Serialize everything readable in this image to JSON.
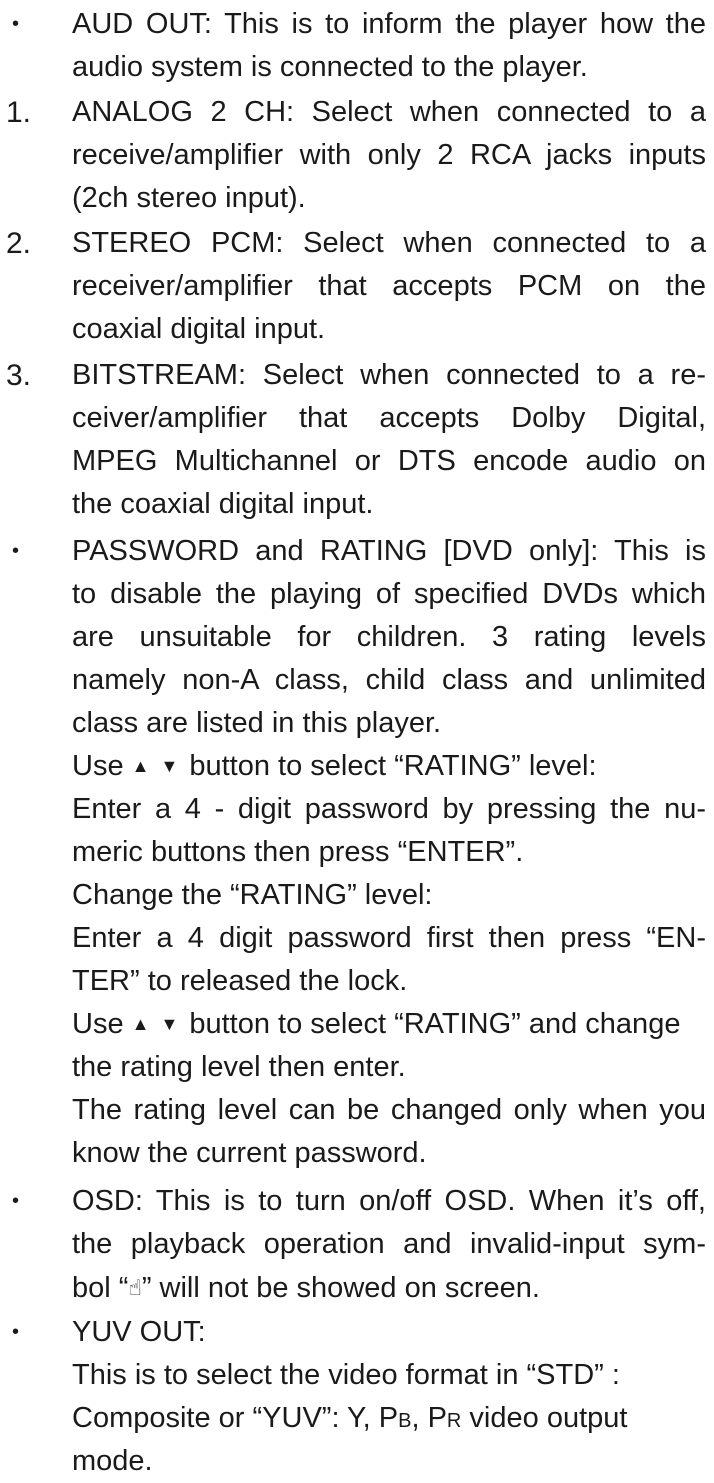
{
  "items": {
    "aud_out": {
      "marker": "•",
      "l1": "AUD OUT: This is to inform the player how the",
      "l2": "audio system is connected to the player."
    },
    "analog": {
      "marker": "1.",
      "l1": "ANALOG 2 CH: Select when connected to a",
      "l2": "receive/amplifier with only 2 RCA jacks inputs",
      "l3": "(2ch stereo input)."
    },
    "stereo_pcm": {
      "marker": "2.",
      "l1": "STEREO PCM: Select when connected to a",
      "l2": "receiver/amplifier that accepts PCM on the",
      "l3": "coaxial digital input."
    },
    "bitstream": {
      "marker": "3.",
      "l1": "BITSTREAM: Select when connected to a re-",
      "l2": "ceiver/amplifier that accepts Dolby Digital,",
      "l3": "MPEG Multichannel or DTS encode audio on",
      "l4": "the coaxial digital input."
    },
    "password": {
      "marker": "•",
      "l1": "PASSWORD and RATING [DVD only]: This is",
      "l2": "to disable the playing of specified DVDs which",
      "l3": "are unsuitable for children. 3 rating levels",
      "l4": "namely non-A class, child class and unlimited",
      "l5": "class are listed in this player.",
      "l6_pre": "Use",
      "arrows": "▲ ▼",
      "l6_post": "button to select “RATING” level:",
      "l7": "Enter a 4 - digit password by pressing the nu-",
      "l8": "meric buttons then press “ENTER”.",
      "l9": "Change the “RATING” level:",
      "l10": "Enter a  4 digit password first then press “EN-",
      "l11": "TER” to released the lock.",
      "l12_pre": "Use",
      "l12_post": "button to select “RATING” and change",
      "l13": "the rating level then enter.",
      "l14": "The rating level can be changed only when you",
      "l15": "know the current password."
    },
    "osd": {
      "marker": "•",
      "l1": "OSD: This is to turn on/off OSD. When it’s off,",
      "l2": "the playback operation and invalid-input sym-",
      "l3_pre": "bol “",
      "hand": "☝",
      "l3_post": "” will not be showed on screen."
    },
    "yuv": {
      "marker": "•",
      "l1": "YUV OUT:",
      "l2": "This is to select the video format in “STD” :",
      "l3_pre": "Composite or “YUV”: Y, P",
      "pb_sub": "B",
      "l3_mid": ", P",
      "pr_sub": "R",
      "l3_post": " video output",
      "l4": "mode."
    }
  }
}
